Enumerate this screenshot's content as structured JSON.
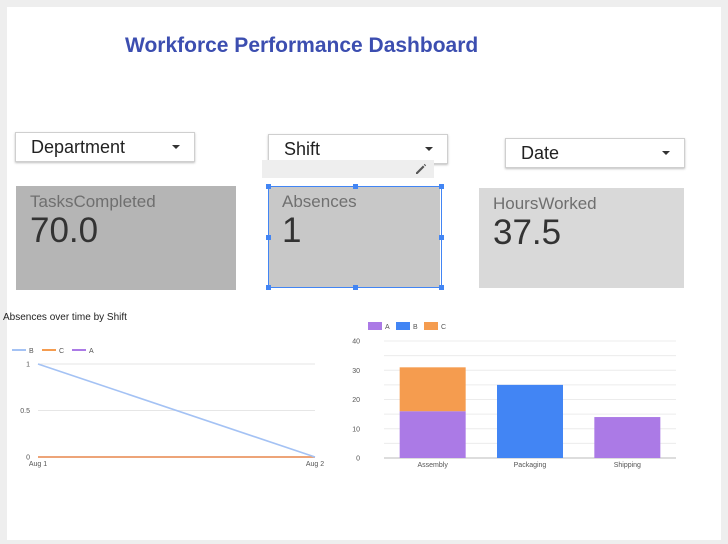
{
  "header": {
    "title": "Workforce Performance Dashboard"
  },
  "filters": {
    "department": {
      "label": "Department"
    },
    "shift": {
      "label": "Shift"
    },
    "date": {
      "label": "Date"
    }
  },
  "scorecards": {
    "tasks": {
      "label": "TasksCompleted",
      "value": "70.0"
    },
    "absences": {
      "label": "Absences",
      "value": "1"
    },
    "hours": {
      "label": "HoursWorked",
      "value": "37.5"
    }
  },
  "colors": {
    "title": "#3c4eb0",
    "series_A": "#ab7ae6",
    "series_B": "#4285f4",
    "series_C": "#f59c4f",
    "line_B": "#a4c2f4",
    "selection": "#4285f4"
  },
  "toolbar": {
    "edit_icon": "pencil-icon"
  },
  "chart_data": [
    {
      "type": "line",
      "title": "Absences over time by Shift",
      "x": [
        "Aug 1",
        "Aug 2"
      ],
      "series": [
        {
          "name": "B",
          "values": [
            1,
            0
          ]
        },
        {
          "name": "C",
          "values": [
            0,
            0
          ]
        },
        {
          "name": "A",
          "values": [
            0,
            0
          ]
        }
      ],
      "ylim": [
        0,
        1
      ],
      "yticks": [
        "0",
        "0.5",
        "1"
      ],
      "grid": true,
      "legend": "top-left"
    },
    {
      "type": "bar",
      "stacked": true,
      "title": "",
      "categories": [
        "Assembly",
        "Packaging",
        "Shipping"
      ],
      "series": [
        {
          "name": "A",
          "values": [
            16,
            0,
            14
          ]
        },
        {
          "name": "B",
          "values": [
            0,
            25,
            0
          ]
        },
        {
          "name": "C",
          "values": [
            15,
            0,
            0
          ]
        }
      ],
      "ylim": [
        0,
        40
      ],
      "yticks": [
        "0",
        "10",
        "20",
        "30",
        "40"
      ],
      "grid": true,
      "legend": "top-left"
    }
  ]
}
